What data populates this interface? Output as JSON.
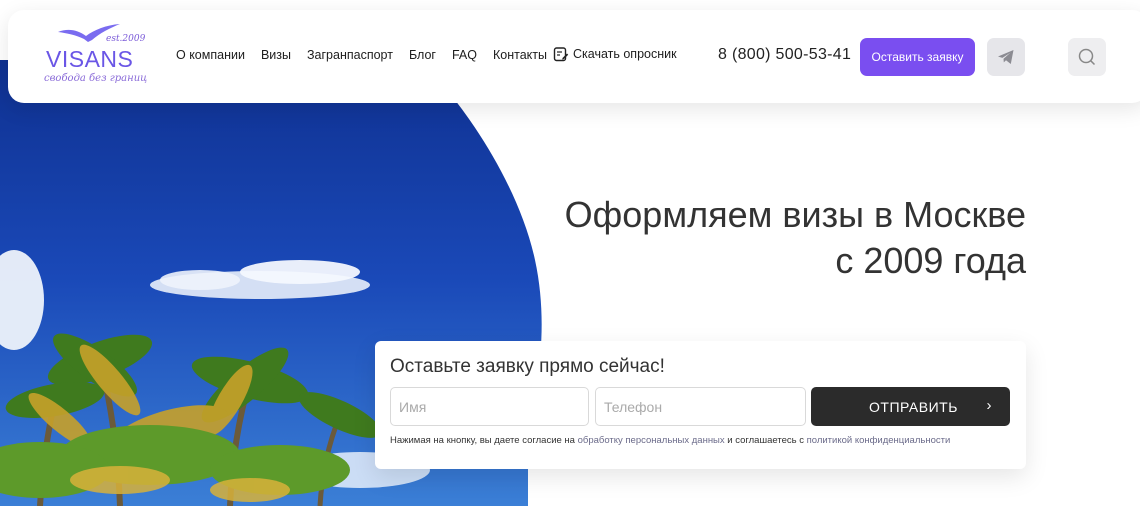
{
  "logo": {
    "word": "VISANS",
    "est": "est.2009",
    "tagline": "свобода без границ"
  },
  "nav": {
    "items": [
      "О компании",
      "Визы",
      "Загранпаспорт",
      "Блог",
      "FAQ",
      "Контакты"
    ],
    "download_label": "Скачать опросник"
  },
  "header": {
    "phone": "8 (800) 500-53-41",
    "request_button": "Оставить заявку",
    "telegram_icon": "telegram-icon",
    "search_icon": "search-icon"
  },
  "hero": {
    "headline_line1": "Оформляем визы в Москве",
    "headline_line2": "с 2009 года"
  },
  "form": {
    "title": "Оставьте заявку прямо сейчас!",
    "name_placeholder": "Имя",
    "phone_placeholder": "Телефон",
    "submit_label": "ОТПРАВИТЬ",
    "consent_prefix": "Нажимая на кнопку, вы даете согласие на",
    "consent_link1": "обработку персональных данных",
    "consent_middle": "и соглашаетесь с",
    "consent_link2": "политикой конфиденциальности"
  },
  "colors": {
    "accent": "#7a4ef0",
    "submit_bg": "#2b2b2b",
    "sky": "#12318f"
  }
}
